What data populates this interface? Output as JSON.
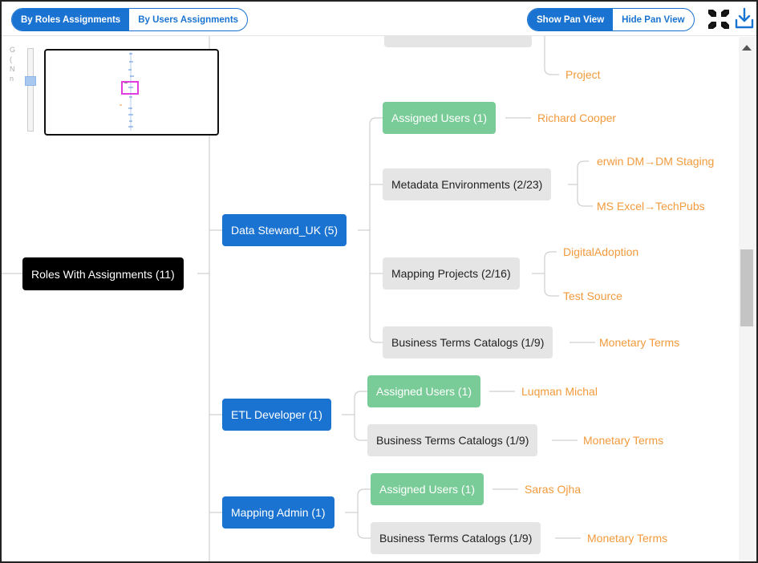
{
  "toolbar": {
    "view_modes": [
      "By Roles Assignments",
      "By Users Assignments"
    ],
    "active_view_mode": "By Roles Assignments",
    "pan_options": [
      "Show Pan View",
      "Hide Pan View"
    ],
    "active_pan_option": "Show Pan View",
    "icons": [
      "fit-to-screen-icon",
      "download-icon"
    ],
    "accent_color": "#1a73d1"
  },
  "tree": {
    "partial_node": "",
    "partial_leaf": "Project",
    "root": "Roles With Assignments (11)",
    "roles": [
      {
        "label": "Data Steward_UK (5)",
        "groups": [
          {
            "label": "Assigned Users (1)",
            "type": "users",
            "items": [
              "Richard Cooper"
            ]
          },
          {
            "label": "Metadata Environments (2/23)",
            "type": "grey",
            "items": [
              "erwin DM→DM Staging",
              "MS Excel→TechPubs"
            ]
          },
          {
            "label": "Mapping Projects (2/16)",
            "type": "grey",
            "items": [
              "DigitalAdoption",
              "Test Source"
            ]
          },
          {
            "label": "Business Terms Catalogs (1/9)",
            "type": "grey",
            "items": [
              "Monetary Terms"
            ]
          }
        ]
      },
      {
        "label": "ETL Developer (1)",
        "groups": [
          {
            "label": "Assigned Users (1)",
            "type": "users",
            "items": [
              "Luqman Michal"
            ]
          },
          {
            "label": "Business Terms Catalogs (1/9)",
            "type": "grey",
            "items": [
              "Monetary Terms"
            ]
          }
        ]
      },
      {
        "label": "Mapping Admin (1)",
        "groups": [
          {
            "label": "Assigned Users (1)",
            "type": "users",
            "items": [
              "Saras Ojha"
            ]
          },
          {
            "label": "Business Terms Catalogs (1/9)",
            "type": "grey",
            "items": [
              "Monetary Terms"
            ]
          }
        ]
      }
    ]
  },
  "colors": {
    "root": "#000000",
    "role": "#1a73d1",
    "assigned_users": "#79cc97",
    "group": "#e5e5e5",
    "leaf_text": "#f39a3c",
    "connector": "#cccccc",
    "pan_view_highlight": "#e03ce0"
  }
}
